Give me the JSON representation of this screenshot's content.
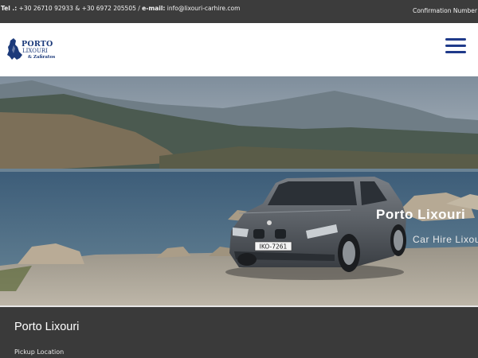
{
  "topbar": {
    "tel_label": "Tel .:",
    "phones": " +30 26710 92933 & +30 6972 205505 / ",
    "email_label": "e-mail:",
    "email": " info@lixouri-carhire.com",
    "confirmation": "Confirmation Number"
  },
  "logo": {
    "line1": "PORTO",
    "line2": "LIXOURI",
    "line3": "& Zafiratos"
  },
  "hero": {
    "title": "Porto Lixouri",
    "subtitle": "Car Hire Lixouri",
    "plate": "IKO-7261"
  },
  "booking": {
    "heading": "Porto Lixouri",
    "pickup_label": "Pickup Location"
  },
  "colors": {
    "topbar_bg": "#3c3c3c",
    "menu_icon": "#1f3a8a",
    "brand": "#1c3a7a",
    "booking_bg": "#3a3a3a"
  }
}
